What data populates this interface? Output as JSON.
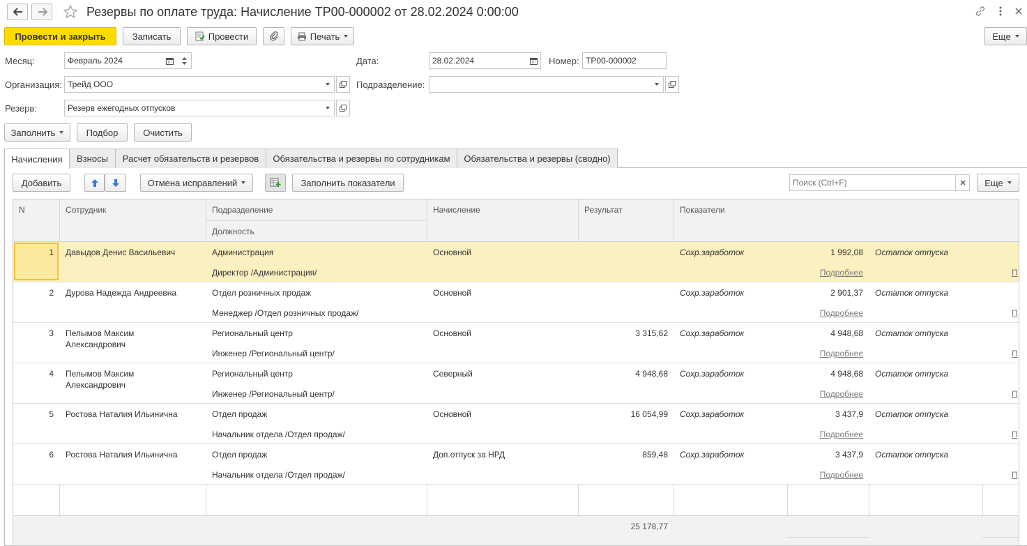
{
  "window": {
    "title": "Резервы по оплате труда: Начисление ТР00-000002 от 28.02.2024 0:00:00"
  },
  "toolbar": {
    "post_close": "Провести и закрыть",
    "save": "Записать",
    "post": "Провести",
    "print": "Печать",
    "more": "Еще"
  },
  "form": {
    "month_label": "Месяц:",
    "month_value": "Февраль 2024",
    "date_label": "Дата:",
    "date_value": "28.02.2024",
    "number_label": "Номер:",
    "number_value": "ТР00-000002",
    "org_label": "Организация:",
    "org_value": "Трейд ООО",
    "dept_label": "Подразделение:",
    "dept_value": "",
    "reserve_label": "Резерв:",
    "reserve_value": "Резерв ежегодных отпусков"
  },
  "actions": {
    "fill": "Заполнить",
    "pick": "Подбор",
    "clear": "Очистить"
  },
  "tabs": [
    {
      "label": "Начисления"
    },
    {
      "label": "Взносы"
    },
    {
      "label": "Расчет обязательств и резервов"
    },
    {
      "label": "Обязательства и резервы по сотрудникам"
    },
    {
      "label": "Обязательства и резервы (сводно)"
    }
  ],
  "table_toolbar": {
    "add": "Добавить",
    "cancel_fix": "Отмена исправлений",
    "fill_indicators": "Заполнить показатели",
    "search_placeholder": "Поиск (Ctrl+F)",
    "more": "Еще"
  },
  "table": {
    "headers": {
      "n": "N",
      "employee": "Сотрудник",
      "department": "Подразделение",
      "position": "Должность",
      "accrual": "Начисление",
      "result": "Результат",
      "indicators": "Показатели"
    },
    "rows": [
      {
        "n": "1",
        "employee": "Давыдов Денис Васильевич",
        "employee2": "",
        "department": "Администрация",
        "position": "Директор /Администрация/",
        "accrual": "Основной",
        "result": "",
        "ind1": "Сохр.заработок",
        "val1": "1 992,08",
        "more1": "Подробнее",
        "ind2": "Остаток отпуска",
        "more2": "П"
      },
      {
        "n": "2",
        "employee": "Дурова Надежда Андреевна",
        "employee2": "",
        "department": "Отдел розничных продаж",
        "position": "Менеджер /Отдел розничных продаж/",
        "accrual": "Основной",
        "result": "",
        "ind1": "Сохр.заработок",
        "val1": "2 901,37",
        "more1": "Подробнее",
        "ind2": "Остаток отпуска",
        "more2": "П"
      },
      {
        "n": "3",
        "employee": "Пелымов Максим",
        "employee2": "Александрович",
        "department": "Региональный центр",
        "position": "Инженер /Региональный центр/",
        "accrual": "Основной",
        "result": "3 315,62",
        "ind1": "Сохр.заработок",
        "val1": "4 948,68",
        "more1": "Подробнее",
        "ind2": "Остаток отпуска",
        "more2": "П"
      },
      {
        "n": "4",
        "employee": "Пелымов Максим",
        "employee2": "Александрович",
        "department": "Региональный центр",
        "position": "Инженер /Региональный центр/",
        "accrual": "Северный",
        "result": "4 948,68",
        "ind1": "Сохр.заработок",
        "val1": "4 948,68",
        "more1": "Подробнее",
        "ind2": "Остаток отпуска",
        "more2": "П"
      },
      {
        "n": "5",
        "employee": "Ростова Наталия Ильинична",
        "employee2": "",
        "department": "Отдел продаж",
        "position": "Начальник отдела /Отдел продаж/",
        "accrual": "Основной",
        "result": "16 054,99",
        "ind1": "Сохр.заработок",
        "val1": "3 437,9",
        "more1": "Подробнее",
        "ind2": "Остаток отпуска",
        "more2": "П"
      },
      {
        "n": "6",
        "employee": "Ростова Наталия Ильинична",
        "employee2": "",
        "department": "Отдел продаж",
        "position": "Начальник отдела /Отдел продаж/",
        "accrual": "Доп.отпуск за НРД",
        "result": "859,48",
        "ind1": "Сохр.заработок",
        "val1": "3 437,9",
        "more1": "Подробнее",
        "ind2": "Остаток отпуска",
        "more2": "П"
      }
    ],
    "total_result": "25 178,77"
  },
  "colors": {
    "primary_button": "#ffdb00",
    "selected_row": "#fbf0c0",
    "selection_border": "#f2c230"
  }
}
